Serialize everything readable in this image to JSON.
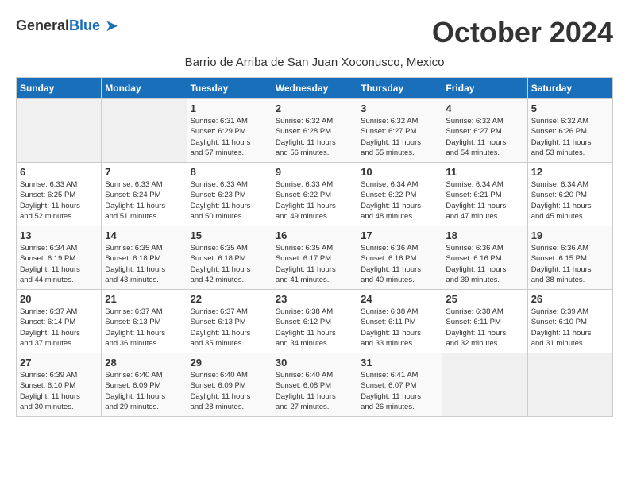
{
  "logo": {
    "general": "General",
    "blue": "Blue"
  },
  "title": "October 2024",
  "subtitle": "Barrio de Arriba de San Juan Xoconusco, Mexico",
  "days_of_week": [
    "Sunday",
    "Monday",
    "Tuesday",
    "Wednesday",
    "Thursday",
    "Friday",
    "Saturday"
  ],
  "weeks": [
    [
      {
        "day": "",
        "info": ""
      },
      {
        "day": "",
        "info": ""
      },
      {
        "day": "1",
        "info": "Sunrise: 6:31 AM\nSunset: 6:29 PM\nDaylight: 11 hours\nand 57 minutes."
      },
      {
        "day": "2",
        "info": "Sunrise: 6:32 AM\nSunset: 6:28 PM\nDaylight: 11 hours\nand 56 minutes."
      },
      {
        "day": "3",
        "info": "Sunrise: 6:32 AM\nSunset: 6:27 PM\nDaylight: 11 hours\nand 55 minutes."
      },
      {
        "day": "4",
        "info": "Sunrise: 6:32 AM\nSunset: 6:27 PM\nDaylight: 11 hours\nand 54 minutes."
      },
      {
        "day": "5",
        "info": "Sunrise: 6:32 AM\nSunset: 6:26 PM\nDaylight: 11 hours\nand 53 minutes."
      }
    ],
    [
      {
        "day": "6",
        "info": "Sunrise: 6:33 AM\nSunset: 6:25 PM\nDaylight: 11 hours\nand 52 minutes."
      },
      {
        "day": "7",
        "info": "Sunrise: 6:33 AM\nSunset: 6:24 PM\nDaylight: 11 hours\nand 51 minutes."
      },
      {
        "day": "8",
        "info": "Sunrise: 6:33 AM\nSunset: 6:23 PM\nDaylight: 11 hours\nand 50 minutes."
      },
      {
        "day": "9",
        "info": "Sunrise: 6:33 AM\nSunset: 6:22 PM\nDaylight: 11 hours\nand 49 minutes."
      },
      {
        "day": "10",
        "info": "Sunrise: 6:34 AM\nSunset: 6:22 PM\nDaylight: 11 hours\nand 48 minutes."
      },
      {
        "day": "11",
        "info": "Sunrise: 6:34 AM\nSunset: 6:21 PM\nDaylight: 11 hours\nand 47 minutes."
      },
      {
        "day": "12",
        "info": "Sunrise: 6:34 AM\nSunset: 6:20 PM\nDaylight: 11 hours\nand 45 minutes."
      }
    ],
    [
      {
        "day": "13",
        "info": "Sunrise: 6:34 AM\nSunset: 6:19 PM\nDaylight: 11 hours\nand 44 minutes."
      },
      {
        "day": "14",
        "info": "Sunrise: 6:35 AM\nSunset: 6:18 PM\nDaylight: 11 hours\nand 43 minutes."
      },
      {
        "day": "15",
        "info": "Sunrise: 6:35 AM\nSunset: 6:18 PM\nDaylight: 11 hours\nand 42 minutes."
      },
      {
        "day": "16",
        "info": "Sunrise: 6:35 AM\nSunset: 6:17 PM\nDaylight: 11 hours\nand 41 minutes."
      },
      {
        "day": "17",
        "info": "Sunrise: 6:36 AM\nSunset: 6:16 PM\nDaylight: 11 hours\nand 40 minutes."
      },
      {
        "day": "18",
        "info": "Sunrise: 6:36 AM\nSunset: 6:16 PM\nDaylight: 11 hours\nand 39 minutes."
      },
      {
        "day": "19",
        "info": "Sunrise: 6:36 AM\nSunset: 6:15 PM\nDaylight: 11 hours\nand 38 minutes."
      }
    ],
    [
      {
        "day": "20",
        "info": "Sunrise: 6:37 AM\nSunset: 6:14 PM\nDaylight: 11 hours\nand 37 minutes."
      },
      {
        "day": "21",
        "info": "Sunrise: 6:37 AM\nSunset: 6:13 PM\nDaylight: 11 hours\nand 36 minutes."
      },
      {
        "day": "22",
        "info": "Sunrise: 6:37 AM\nSunset: 6:13 PM\nDaylight: 11 hours\nand 35 minutes."
      },
      {
        "day": "23",
        "info": "Sunrise: 6:38 AM\nSunset: 6:12 PM\nDaylight: 11 hours\nand 34 minutes."
      },
      {
        "day": "24",
        "info": "Sunrise: 6:38 AM\nSunset: 6:11 PM\nDaylight: 11 hours\nand 33 minutes."
      },
      {
        "day": "25",
        "info": "Sunrise: 6:38 AM\nSunset: 6:11 PM\nDaylight: 11 hours\nand 32 minutes."
      },
      {
        "day": "26",
        "info": "Sunrise: 6:39 AM\nSunset: 6:10 PM\nDaylight: 11 hours\nand 31 minutes."
      }
    ],
    [
      {
        "day": "27",
        "info": "Sunrise: 6:39 AM\nSunset: 6:10 PM\nDaylight: 11 hours\nand 30 minutes."
      },
      {
        "day": "28",
        "info": "Sunrise: 6:40 AM\nSunset: 6:09 PM\nDaylight: 11 hours\nand 29 minutes."
      },
      {
        "day": "29",
        "info": "Sunrise: 6:40 AM\nSunset: 6:09 PM\nDaylight: 11 hours\nand 28 minutes."
      },
      {
        "day": "30",
        "info": "Sunrise: 6:40 AM\nSunset: 6:08 PM\nDaylight: 11 hours\nand 27 minutes."
      },
      {
        "day": "31",
        "info": "Sunrise: 6:41 AM\nSunset: 6:07 PM\nDaylight: 11 hours\nand 26 minutes."
      },
      {
        "day": "",
        "info": ""
      },
      {
        "day": "",
        "info": ""
      }
    ]
  ]
}
